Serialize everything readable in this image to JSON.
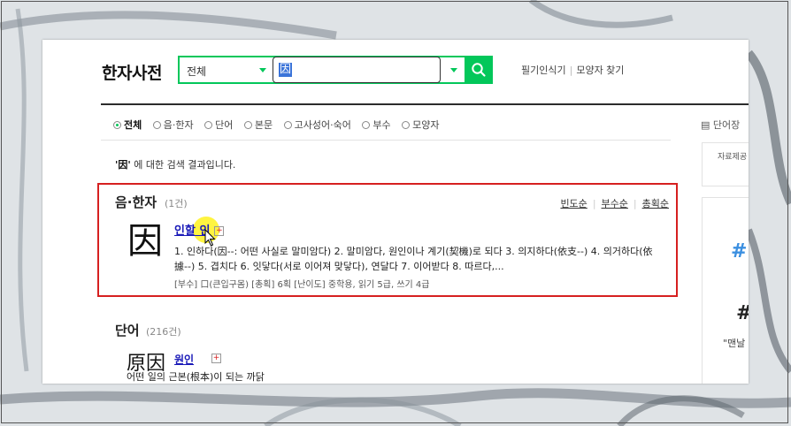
{
  "header": {
    "logo": "한자사전",
    "category": "전체",
    "query": "因",
    "links": [
      "필기인식기",
      "모양자 찾기"
    ]
  },
  "filters": [
    {
      "label": "전체",
      "selected": true
    },
    {
      "label": "음·한자",
      "selected": false
    },
    {
      "label": "단어",
      "selected": false
    },
    {
      "label": "본문",
      "selected": false
    },
    {
      "label": "고사성어·숙어",
      "selected": false
    },
    {
      "label": "부수",
      "selected": false
    },
    {
      "label": "모양자",
      "selected": false
    }
  ],
  "sidebar": {
    "heading": "단어장",
    "box_text": "자료제공",
    "ad_line1": "#",
    "ad_line2": "#",
    "ad_text": "\"맨날"
  },
  "results": {
    "message_query": "'因'",
    "message_rest": " 에 대한 검색 결과입니다."
  },
  "eum_hanja": {
    "title": "음·한자",
    "count": "(1건)",
    "sorts": [
      "빈도순",
      "부수순",
      "총획순"
    ],
    "char": "因",
    "entry_title": "인할 인",
    "definition": "1. 인하다(因--: 어떤 사실로 말미암다) 2. 말미암다, 원인이나 계기(契機)로 되다 3. 의지하다(依支--) 4. 의거하다(依據--) 5. 겹치다 6. 잇닿다(서로 이어져 맞닿다), 연달다 7. 이어받다 8. 따르다,...",
    "meta": "[부수] 口(큰입구몸)  [총획] 6획  [난이도] 중학용, 읽기 5급, 쓰기 4급"
  },
  "words": {
    "title": "단어",
    "count": "(216건)",
    "items": [
      {
        "hanja": "原因",
        "reading": "원인",
        "definition": "어떤 일의 근본(根本)이 되는 까닭"
      }
    ]
  },
  "colors": {
    "accent": "#03c75a",
    "highlight_box": "#d62020",
    "link": "#1a1ab8"
  }
}
